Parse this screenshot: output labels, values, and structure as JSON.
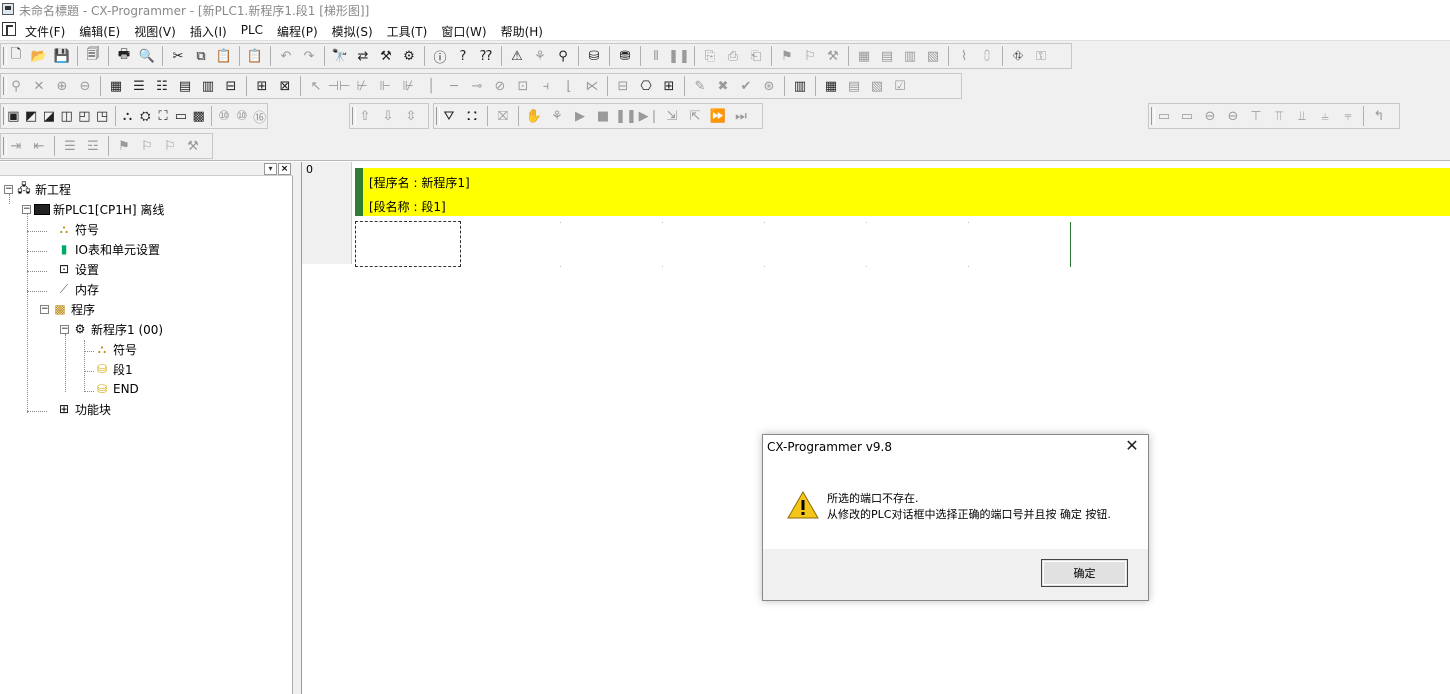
{
  "window": {
    "title": "未命名標題 - CX-Programmer - [新PLC1.新程序1.段1 [梯形图]]"
  },
  "menu": {
    "items": [
      "文件(F)",
      "编辑(E)",
      "视图(V)",
      "插入(I)",
      "PLC",
      "编程(P)",
      "模拟(S)",
      "工具(T)",
      "窗口(W)",
      "帮助(H)"
    ]
  },
  "tree": {
    "root": "新工程",
    "plc": "新PLC1[CP1H] 离线",
    "symbols": "符号",
    "io_table": "IO表和单元设置",
    "settings": "设置",
    "memory": "内存",
    "programs": "程序",
    "program1": "新程序1 (00)",
    "program_symbols": "符号",
    "section1": "段1",
    "end": "END",
    "function_blocks": "功能块"
  },
  "editor": {
    "rung_number": "0",
    "program_name_line": "[程序名 : 新程序1]",
    "section_name_line": "[段名称 : 段1]"
  },
  "dialog": {
    "title": "CX-Programmer v9.8",
    "message_line1": "所选的端口不存在.",
    "message_line2": "从修改的PLC对话框中选择正确的端口号并且按 确定 按钮.",
    "ok_label": "确定"
  },
  "colors": {
    "comment_highlight": "#ffff00",
    "rung_marker": "#2e7d32"
  }
}
